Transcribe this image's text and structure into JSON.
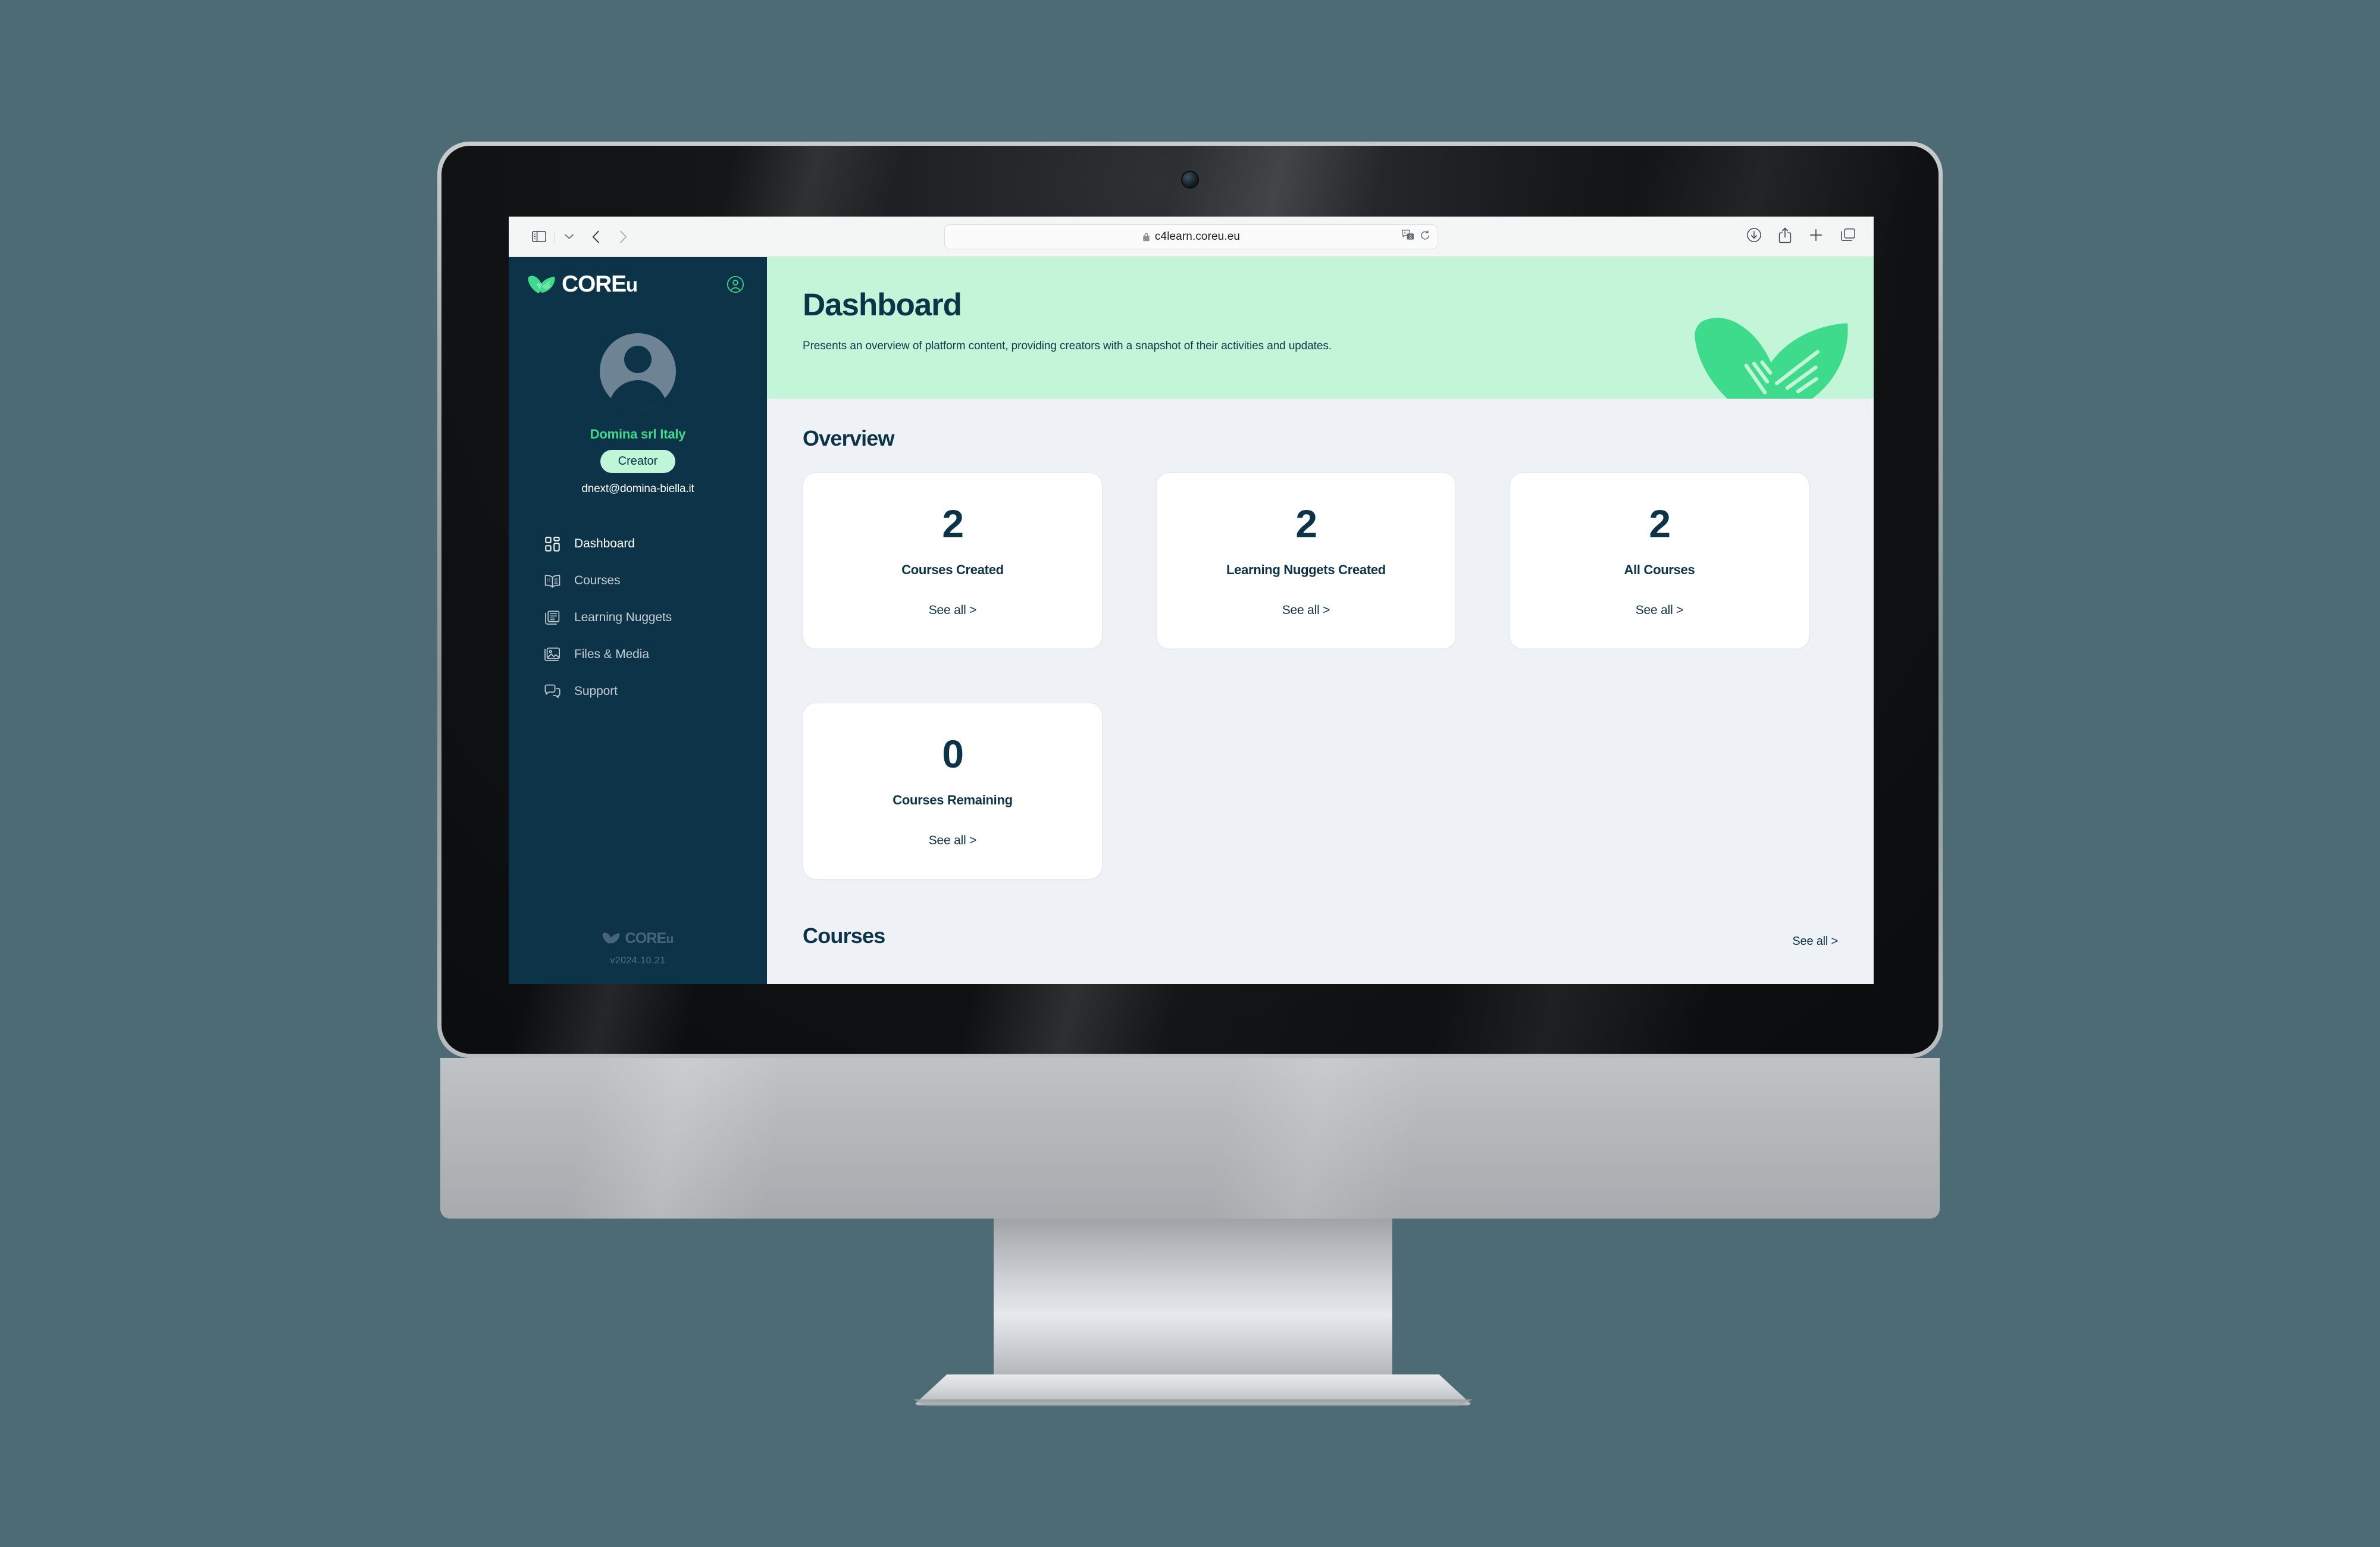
{
  "browser": {
    "sidebar_toggle_icon": "sidebar-panel-icon",
    "sidebar_dropdown_icon": "chevron-down-icon",
    "back_icon": "chevron-left-icon",
    "forward_icon": "chevron-right-icon",
    "url": "c4learn.coreu.eu",
    "lock_icon": "lock-icon",
    "translate_icon": "translate-icon",
    "reload_icon": "reload-icon",
    "downloads_icon": "download-icon",
    "share_icon": "share-icon",
    "new_tab_icon": "plus-icon",
    "tab_overview_icon": "tab-overview-icon"
  },
  "sidebar": {
    "brand": {
      "name": "CORE",
      "suffix": "u",
      "logo_icon": "leaf-logo-icon"
    },
    "account_icon": "account-circle-icon",
    "profile": {
      "avatar_icon": "avatar-placeholder-icon",
      "name": "Domina srl Italy",
      "role": "Creator",
      "email": "dnext@domina-biella.it"
    },
    "items": [
      {
        "label": "Dashboard",
        "icon": "dashboard-grid-icon",
        "active": true
      },
      {
        "label": "Courses",
        "icon": "book-icon",
        "active": false
      },
      {
        "label": "Learning Nuggets",
        "icon": "article-stack-icon",
        "active": false
      },
      {
        "label": "Files & Media",
        "icon": "image-folder-icon",
        "active": false
      },
      {
        "label": "Support",
        "icon": "chat-bubbles-icon",
        "active": false
      }
    ],
    "footer": {
      "brand": "CORE",
      "brand_suffix": "u",
      "version": "v2024.10.21"
    }
  },
  "page": {
    "title": "Dashboard",
    "subtitle": "Presents an overview of platform content, providing creators with a snapshot of their activities and updates.",
    "header_leaf_icon": "leaf-logo-icon"
  },
  "overview": {
    "heading": "Overview",
    "cards": [
      {
        "value": "2",
        "label": "Courses Created",
        "link": "See all >"
      },
      {
        "value": "2",
        "label": "Learning Nuggets Created",
        "link": "See all >"
      },
      {
        "value": "2",
        "label": "All Courses",
        "link": "See all >"
      },
      {
        "value": "0",
        "label": "Courses Remaining",
        "link": "See all >"
      }
    ]
  },
  "courses_section": {
    "heading": "Courses",
    "link": "See all >"
  },
  "colors": {
    "sidebar_bg": "#0c3348",
    "brand_green": "#3ddb8b",
    "header_mint": "#c3f6d8",
    "badge_mint": "#bff6d7",
    "content_bg": "#eef2f7",
    "card_bg": "#ffffff",
    "text_navy": "#0c3348",
    "desktop_bg": "#4d6b75"
  }
}
